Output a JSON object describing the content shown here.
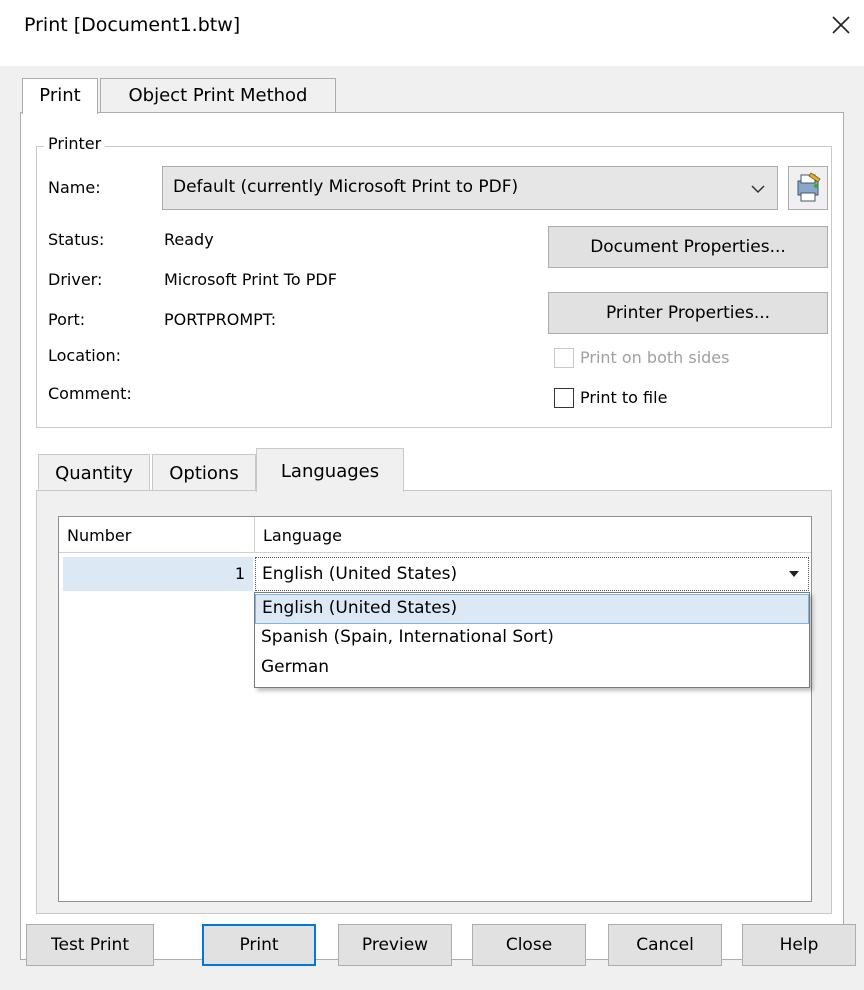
{
  "window": {
    "title": "Print [Document1.btw]"
  },
  "tabs": [
    "Print",
    "Object Print Method"
  ],
  "printer": {
    "group_label": "Printer",
    "name_label": "Name:",
    "name_value": "Default (currently Microsoft Print to PDF)",
    "status_label": "Status:",
    "status_value": "Ready",
    "driver_label": "Driver:",
    "driver_value": "Microsoft Print To PDF",
    "port_label": "Port:",
    "port_value": "PORTPROMPT:",
    "location_label": "Location:",
    "comment_label": "Comment:",
    "document_properties": "Document Properties...",
    "printer_properties": "Printer Properties...",
    "print_both_sides": "Print on both sides",
    "print_to_file": "Print to file"
  },
  "subtabs": [
    "Quantity",
    "Options",
    "Languages"
  ],
  "grid": {
    "headers": [
      "Number",
      "Language"
    ],
    "rows": [
      {
        "number": "1",
        "language": "English (United States)"
      }
    ]
  },
  "dropdown_options": [
    "English (United States)",
    "Spanish (Spain, International Sort)",
    "German"
  ],
  "buttons": {
    "test_print": "Test Print",
    "print": "Print",
    "preview": "Preview",
    "close": "Close",
    "cancel": "Cancel",
    "help": "Help"
  },
  "colors": {
    "accent": "#0078d7",
    "selection": "#dde8f5"
  }
}
